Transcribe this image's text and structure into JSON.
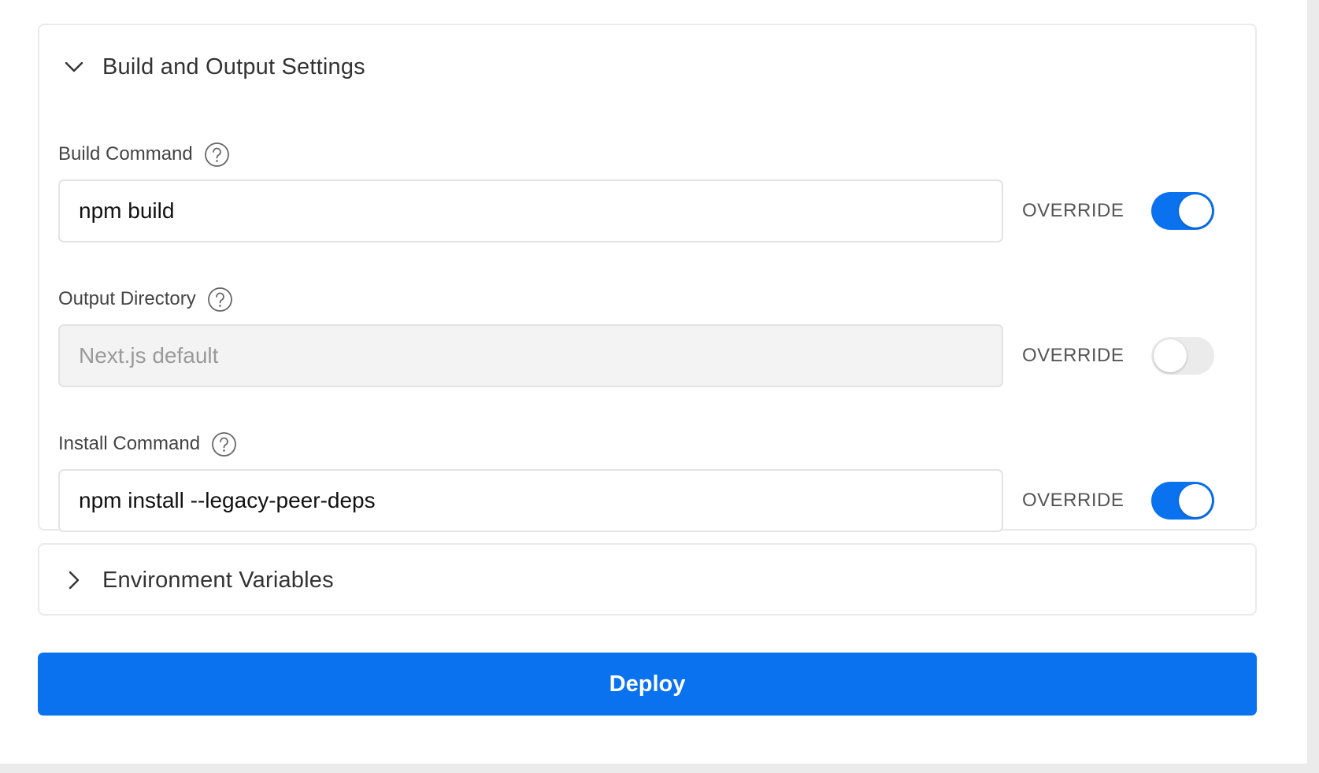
{
  "build_section": {
    "title": "Build and Output Settings",
    "expanded": true,
    "chevron_icon": "chevron-down-icon",
    "fields": [
      {
        "label": "Build Command",
        "help_icon": "help-circle-icon",
        "value": "npm build",
        "placeholder": "",
        "override_label": "OVERRIDE",
        "override_enabled": true
      },
      {
        "label": "Output Directory",
        "help_icon": "help-circle-icon",
        "value": "",
        "placeholder": "Next.js default",
        "override_label": "OVERRIDE",
        "override_enabled": false
      },
      {
        "label": "Install Command",
        "help_icon": "help-circle-icon",
        "value": "npm install --legacy-peer-deps",
        "placeholder": "",
        "override_label": "OVERRIDE",
        "override_enabled": true
      }
    ]
  },
  "env_section": {
    "title": "Environment Variables",
    "expanded": false,
    "chevron_icon": "chevron-right-icon"
  },
  "deploy_button": {
    "label": "Deploy"
  },
  "colors": {
    "accent": "#0a72ef",
    "toggle_off": "#ebebeb",
    "border": "#eaeaea"
  }
}
